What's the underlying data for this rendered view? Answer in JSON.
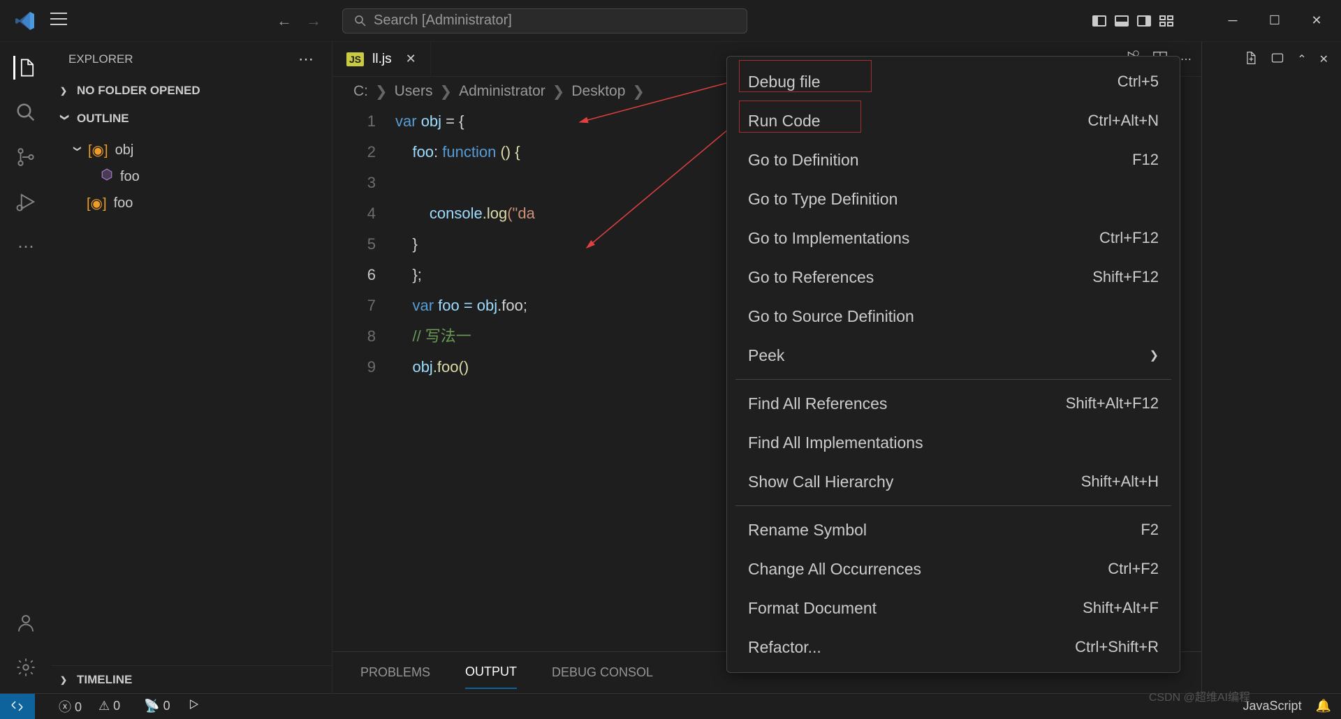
{
  "titlebar": {
    "search_placeholder": "Search [Administrator]"
  },
  "sidebar": {
    "title": "EXPLORER",
    "no_folder": "NO FOLDER OPENED",
    "outline": "OUTLINE",
    "timeline": "TIMELINE",
    "tree": {
      "item0": "obj",
      "item1": "foo",
      "item2": "foo"
    }
  },
  "tab": {
    "type": "JS",
    "name": "ll.js"
  },
  "breadcrumb": {
    "p0": "C:",
    "p1": "Users",
    "p2": "Administrator",
    "p3": "Desktop"
  },
  "code": {
    "ln1": "1",
    "ln2": "2",
    "ln3": "3",
    "ln4": "4",
    "ln5": "5",
    "ln6": "6",
    "ln7": "7",
    "ln8": "8",
    "ln9": "9",
    "l1_var": "var",
    "l1_obj": "obj",
    "l1_eq": " = {",
    "l2_foo": "foo",
    "l2_fn": ": ",
    "l2_kw": "function",
    "l2_par": " () {",
    "l4_console": "console",
    "l4_log": ".log",
    "l4_str": "(\"da",
    "l5": "}",
    "l6": "};",
    "l7_var": "var",
    "l7_foo": " foo = ",
    "l7_obj": "obj",
    "l7_dot": ".foo;",
    "l8": "// 写法一",
    "l9_obj": "obj",
    "l9_call": ".foo()"
  },
  "panel": {
    "problems": "PROBLEMS",
    "output": "OUTPUT",
    "debug": "DEBUG CONSOL"
  },
  "menu": {
    "m0": {
      "label": "Debug file",
      "sc": "Ctrl+5"
    },
    "m1": {
      "label": "Run Code",
      "sc": "Ctrl+Alt+N"
    },
    "m2": {
      "label": "Go to Definition",
      "sc": "F12"
    },
    "m3": {
      "label": "Go to Type Definition",
      "sc": ""
    },
    "m4": {
      "label": "Go to Implementations",
      "sc": "Ctrl+F12"
    },
    "m5": {
      "label": "Go to References",
      "sc": "Shift+F12"
    },
    "m6": {
      "label": "Go to Source Definition",
      "sc": ""
    },
    "m7": {
      "label": "Peek",
      "sc": ""
    },
    "m8": {
      "label": "Find All References",
      "sc": "Shift+Alt+F12"
    },
    "m9": {
      "label": "Find All Implementations",
      "sc": ""
    },
    "m10": {
      "label": "Show Call Hierarchy",
      "sc": "Shift+Alt+H"
    },
    "m11": {
      "label": "Rename Symbol",
      "sc": "F2"
    },
    "m12": {
      "label": "Change All Occurrences",
      "sc": "Ctrl+F2"
    },
    "m13": {
      "label": "Format Document",
      "sc": "Shift+Alt+F"
    },
    "m14": {
      "label": "Refactor...",
      "sc": "Ctrl+Shift+R"
    }
  },
  "status": {
    "errors": "0",
    "warnings": "0",
    "ports": "0",
    "lang": "JavaScript"
  },
  "watermark": "CSDN @超维AI编程"
}
